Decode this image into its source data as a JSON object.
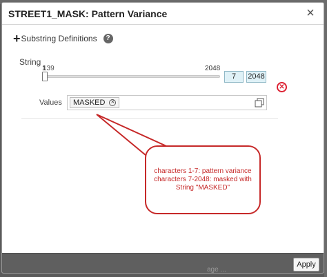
{
  "dialog": {
    "title": "STREET1_MASK: Pattern Variance",
    "close_icon": "close-icon"
  },
  "substring": {
    "plus_icon": "plus-icon",
    "label": "Substring Definitions",
    "help_icon": "help-icon",
    "help_glyph": "?"
  },
  "string_field": {
    "label": "String",
    "slider_min_label": "1",
    "slider_overlap_label": "139",
    "slider_max_label": "2048",
    "range_start": "7",
    "range_end": "2048",
    "remove_icon": "remove-circle-icon",
    "remove_glyph": "✕"
  },
  "values_field": {
    "label": "Values",
    "tag_value": "MASKED",
    "tag_remove_glyph": "✕",
    "expand_icon": "expand-icon"
  },
  "annotation": {
    "text": "characters 1-7: pattern variance characters 7-2048: masked with String \"MASKED\""
  },
  "footer": {
    "apply_label": "Apply"
  },
  "background_text": "age ..."
}
